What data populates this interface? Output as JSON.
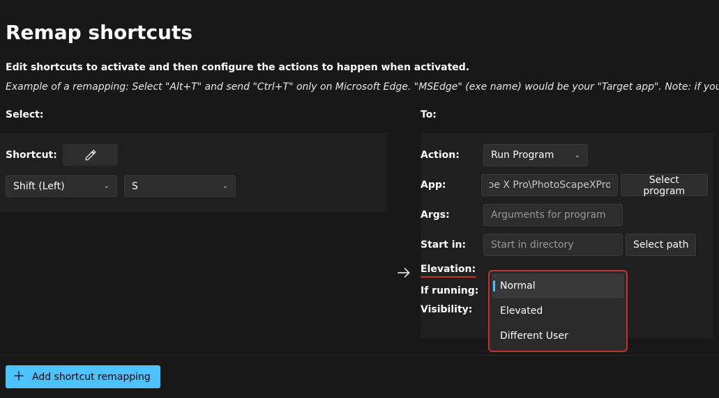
{
  "page_title": "Remap shortcuts",
  "intro_bold": "Edit shortcuts to activate and then configure the actions to happen when activated.",
  "intro_example": "Example of a remapping: Select \"Alt+T\" and send \"Ctrl+T\" only on Microsoft Edge. \"MSEdge\" (exe name) would be your \"Target app\". Note: if you remapped a key, that wi",
  "select_label": "Select:",
  "to_label": "To:",
  "shortcut_label": "Shortcut:",
  "shortcut_key1": "Shift (Left)",
  "shortcut_key2": "S",
  "action": {
    "label": "Action:",
    "value": "Run Program"
  },
  "app": {
    "label": "App:",
    "value": "ɔe X Pro\\PhotoScapeXPro.exe",
    "button": "Select program"
  },
  "args": {
    "label": "Args:",
    "placeholder": "Arguments for program"
  },
  "startin": {
    "label": "Start in:",
    "placeholder": "Start in directory",
    "button": "Select path"
  },
  "elevation_label": "Elevation:",
  "ifrunning_label": "If running:",
  "visibility_label": "Visibility:",
  "elevation_options": {
    "o0": "Normal",
    "o1": "Elevated",
    "o2": "Different User"
  },
  "add_button": "Add shortcut remapping"
}
